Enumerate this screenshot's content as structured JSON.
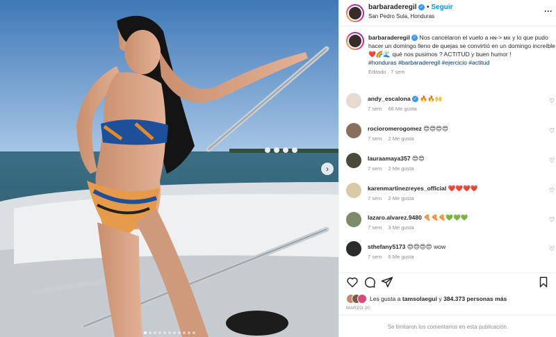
{
  "header": {
    "username": "barbaraderegil",
    "separator": "•",
    "follow_label": "Seguir",
    "location": "San Pedro Sula, Honduras",
    "more_icon": "more-horizontal-icon"
  },
  "caption": {
    "username": "barbaraderegil",
    "text": "Nos cancelaron el vuelo a ʜɴ-> ᴍx y lo que pudo hacer un domingo lleno de quejas se convirtió en un domingo increíble ❤️🌈🌊 qué nos pusimos ? ACTITUD y buen humor !",
    "hashtags": "#honduras #barbaraderegil #ejercicio #actitud",
    "meta": "Editado · 7 sem"
  },
  "comments": [
    {
      "username": "andy_escalona",
      "verified": true,
      "text": "🔥🔥🙌",
      "time": "7 sem",
      "likes": "66 Me gusta"
    },
    {
      "username": "rocioromerogomez",
      "verified": false,
      "text": "😍😍😍😍",
      "time": "7 sem",
      "likes": "2 Me gusta"
    },
    {
      "username": "lauraamaya357",
      "verified": false,
      "text": "😍😍",
      "time": "7 sem",
      "likes": "2 Me gusta"
    },
    {
      "username": "karenmartinezreyes_official",
      "verified": false,
      "text": "❤️❤️❤️❤️",
      "time": "7 sem",
      "likes": "2 Me gusta"
    },
    {
      "username": "lazaro.alvarez.9480",
      "verified": false,
      "text": "🍕🍕🍕💚💚💚",
      "time": "7 sem",
      "likes": "3 Me gusta"
    },
    {
      "username": "sthefany5173",
      "verified": false,
      "text": "😍😍😍😍 wow",
      "time": "7 sem",
      "likes": "6 Me gusta"
    }
  ],
  "likes": {
    "prefix": "Les gusta a",
    "user": "tamsolaegui",
    "connector": "y",
    "count": "384.373 personas más"
  },
  "date": "MARZO 20",
  "comments_limited": "Se limitaron los comentarios en esta publicación.",
  "icons": {
    "like": "heart-icon",
    "comment": "comment-icon",
    "share": "share-icon",
    "save": "bookmark-icon",
    "next": "chevron-right-icon"
  },
  "colors": {
    "accent": "#0095f6",
    "verified": "#3897f0",
    "hashtag": "#00376b",
    "muted": "#8e8e8e"
  }
}
